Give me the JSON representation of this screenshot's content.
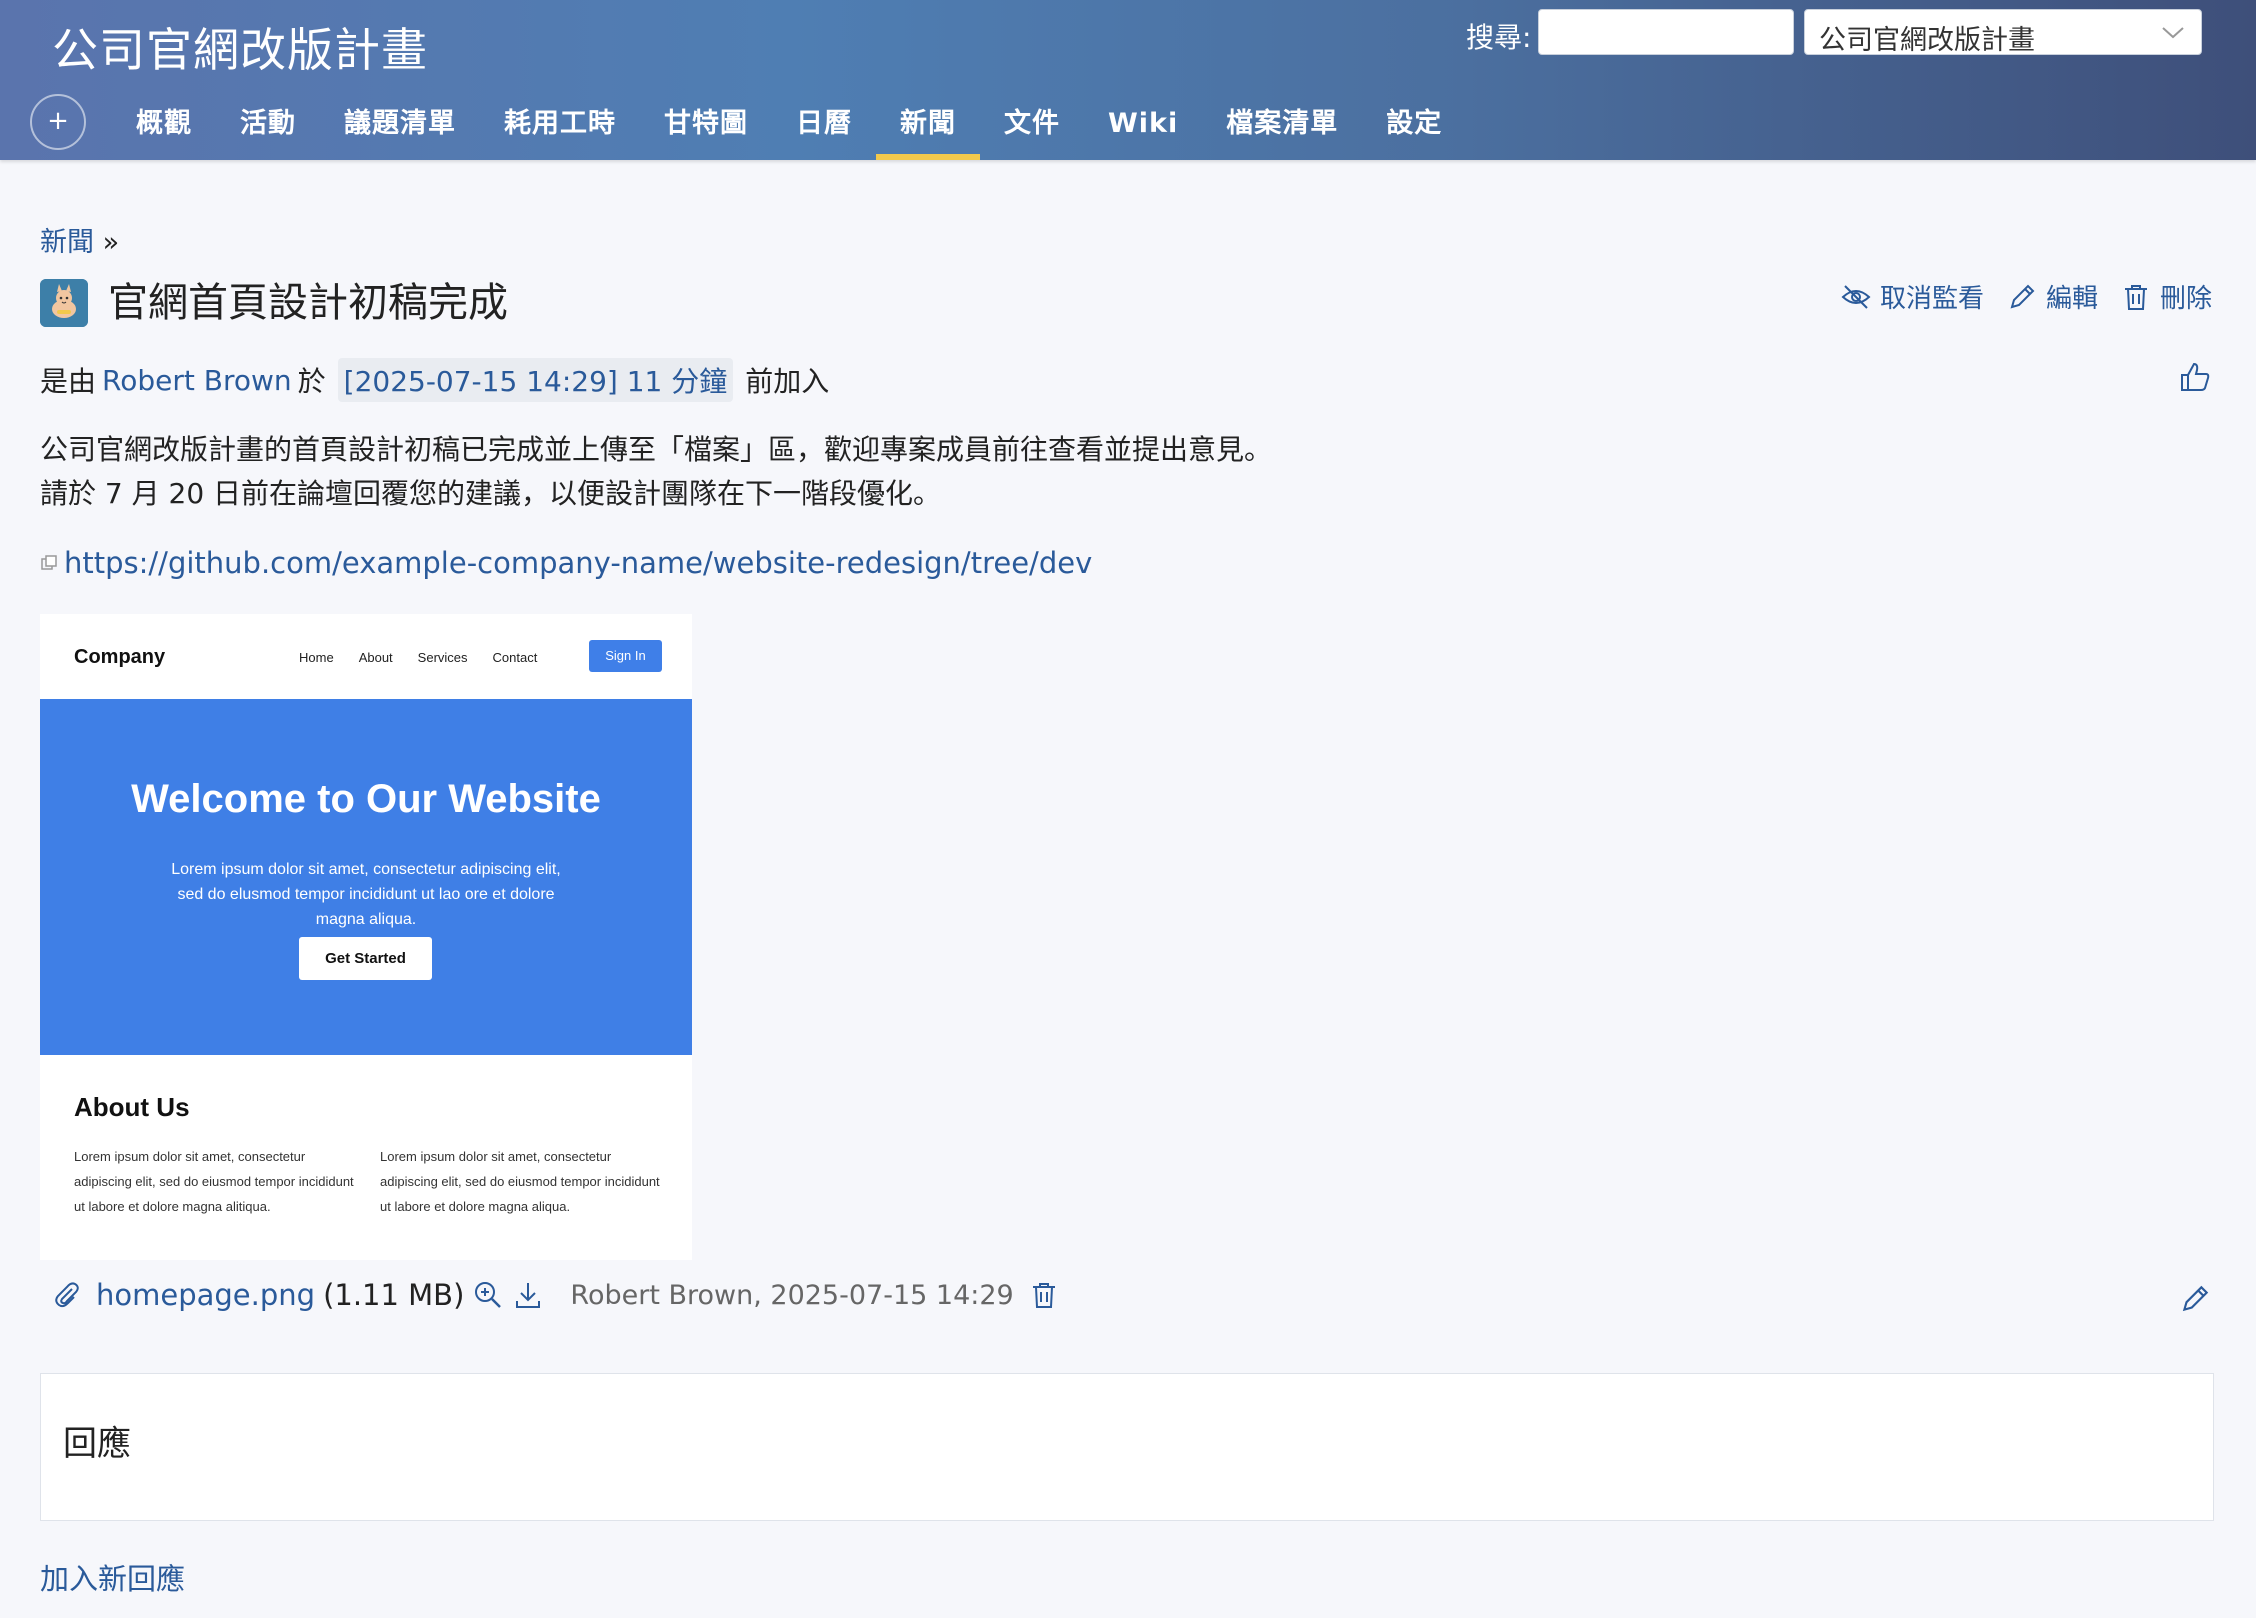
{
  "header": {
    "app_title": "公司官網改版計畫",
    "search_label": "搜尋:",
    "search_value": "",
    "project_select": "公司官網改版計畫",
    "plus_label": "+"
  },
  "tabs": [
    {
      "label": "概觀"
    },
    {
      "label": "活動"
    },
    {
      "label": "議題清單"
    },
    {
      "label": "耗用工時"
    },
    {
      "label": "甘特圖"
    },
    {
      "label": "日曆"
    },
    {
      "label": "新聞",
      "active": true
    },
    {
      "label": "文件"
    },
    {
      "label": "Wiki"
    },
    {
      "label": "檔案清單"
    },
    {
      "label": "設定"
    }
  ],
  "breadcrumb": {
    "link": "新聞",
    "sep": "»"
  },
  "news": {
    "title": "官網首頁設計初稿完成",
    "actions": {
      "unwatch": "取消監看",
      "edit": "編輯",
      "delete": "刪除"
    },
    "byline": {
      "prefix": "是由",
      "author": "Robert Brown",
      "at": "於",
      "when": "[2025-07-15 14:29] 11 分鐘",
      "suffix": "前加入"
    },
    "description": [
      "公司官網改版計畫的首頁設計初稿已完成並上傳至「檔案」區，歡迎專案成員前往查看並提出意見。",
      "請於 7 月 20 日前在論壇回覆您的建議，以便設計團隊在下一階段優化。"
    ],
    "link": "https://github.com/example-company-name/website-redesign/tree/dev"
  },
  "preview": {
    "brand": "Company",
    "menu": [
      "Home",
      "About",
      "Services",
      "Contact"
    ],
    "signin": "Sign In",
    "hero_title": "Welcome to Our Website",
    "hero_text": "Lorem ipsum dolor sit amet, consectetur adipiscing elit, sed do elusmod tempor incididunt ut lao ore et dolore magna aliqua.",
    "cta": "Get Started",
    "about_title": "About Us",
    "col1": "Lorem ipsum dolor sit amet, consectetur adipiscing elit, sed do eiusmod tempor incididunt ut labore et dolore magna alitiqua.",
    "col2": "Lorem ipsum dolor sit amet, consectetur adipiscing elit, sed do eiusmod tempor incididunt ut labore et dolore magna aliqua."
  },
  "attachment": {
    "filename": "homepage.png",
    "size": "(1.11 MB)",
    "meta": "Robert Brown, 2025-07-15 14:29"
  },
  "comments": {
    "title": "回應",
    "add_link": "加入新回應"
  },
  "colors": {
    "accent": "#2a5a9a",
    "active_tab": "#f2c94c",
    "header_start": "#5a74ad",
    "header_end": "#3e4f7a"
  }
}
